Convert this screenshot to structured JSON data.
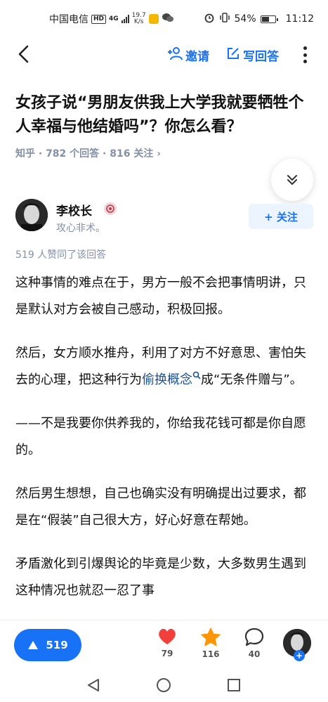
{
  "status_bar": {
    "carrier": "中国电信",
    "hd": "HD",
    "network": "4G",
    "speed_value": "19.7",
    "speed_unit": "K/s",
    "battery": "54%",
    "time": "11:12"
  },
  "nav": {
    "invite_label": "邀请",
    "write_answer_label": "写回答"
  },
  "question": {
    "title": "女孩子说“男朋友供我上大学我就要牺牲个人幸福与他结婚吗”？你怎么看？",
    "meta": "知乎 · 782 个回答 · 816 关注 ›"
  },
  "author": {
    "name": "李校长",
    "bio": "攻心非术。",
    "follow_label": "+ 关注"
  },
  "answer": {
    "agree_text": "519 人赞同了该回答",
    "paragraphs": [
      "这种事情的难点在于，男方一般不会把事情明讲，只是默认对方会被自己感动，积极回报。",
      "——不是我要你供养我的，你给我花钱可都是你自愿的。",
      "然后男生想想，自己也确实没有明确提出过要求，都是在“假装”自己很大方，好心好意在帮她。",
      "矛盾激化到引爆舆论的毕竟是少数，大多数男生遇到这种情况也就忍一忍了事"
    ],
    "p2_before": "然后，女方顺水推舟，利用了对方不好意思、害怕失去的心理，把这种行为",
    "p2_keyword": "偷换概念",
    "p2_after": "成“无条件赠与”。"
  },
  "actions": {
    "upvote_count": "519",
    "like_count": "79",
    "favorite_count": "116",
    "comment_count": "40",
    "me_plus": "+"
  },
  "colors": {
    "accent": "#1772f6",
    "link": "#175199",
    "heart": "#f1403c",
    "star": "#ff9607",
    "meta_gray": "#8590a6"
  }
}
